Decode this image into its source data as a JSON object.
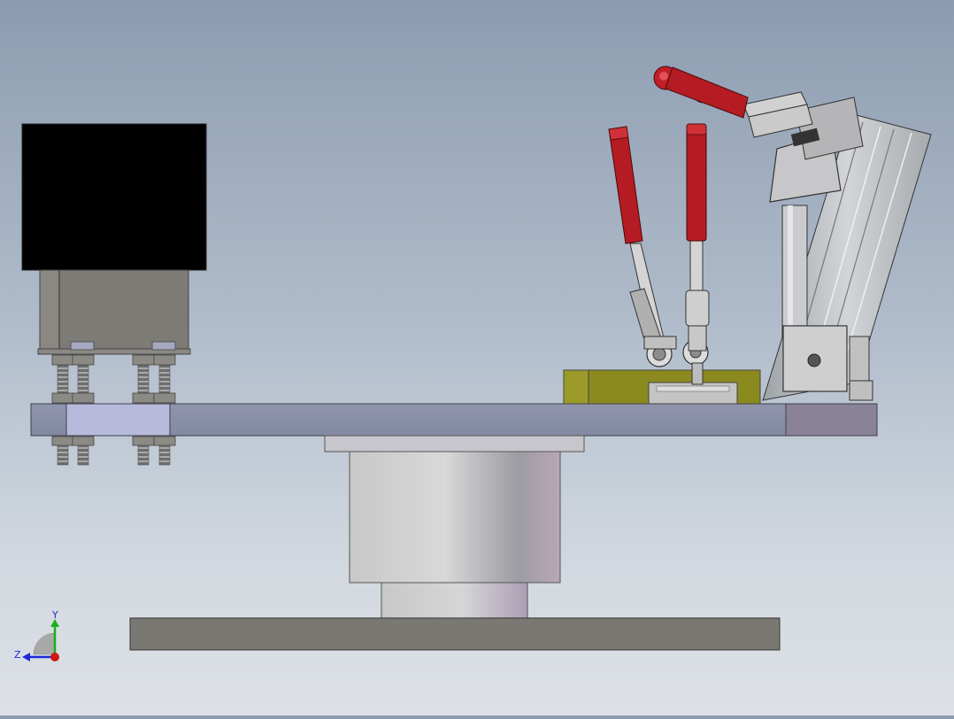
{
  "view": {
    "background_top": "#8c9cb0",
    "background_bottom": "#dde1e6"
  },
  "model": {
    "components": [
      {
        "name": "motor",
        "color": "#000000"
      },
      {
        "name": "motor-mount-bracket",
        "color": "#7c7a74"
      },
      {
        "name": "base-plate",
        "color": "#8b90a8"
      },
      {
        "name": "cylinder-body",
        "color": "#b9b9bd"
      },
      {
        "name": "bottom-plate",
        "color": "#7a7873"
      },
      {
        "name": "toggle-clamp-handle",
        "color": "#b01820"
      },
      {
        "name": "clamp-block",
        "color": "#8a8a1e"
      },
      {
        "name": "aluminum-profile-arm",
        "color": "#bfc2c6"
      }
    ]
  },
  "triad": {
    "y_label": "Y",
    "z_label": "Z",
    "y_color": "#18b018",
    "z_color": "#1b2bd6",
    "x_color": "#d01818"
  }
}
